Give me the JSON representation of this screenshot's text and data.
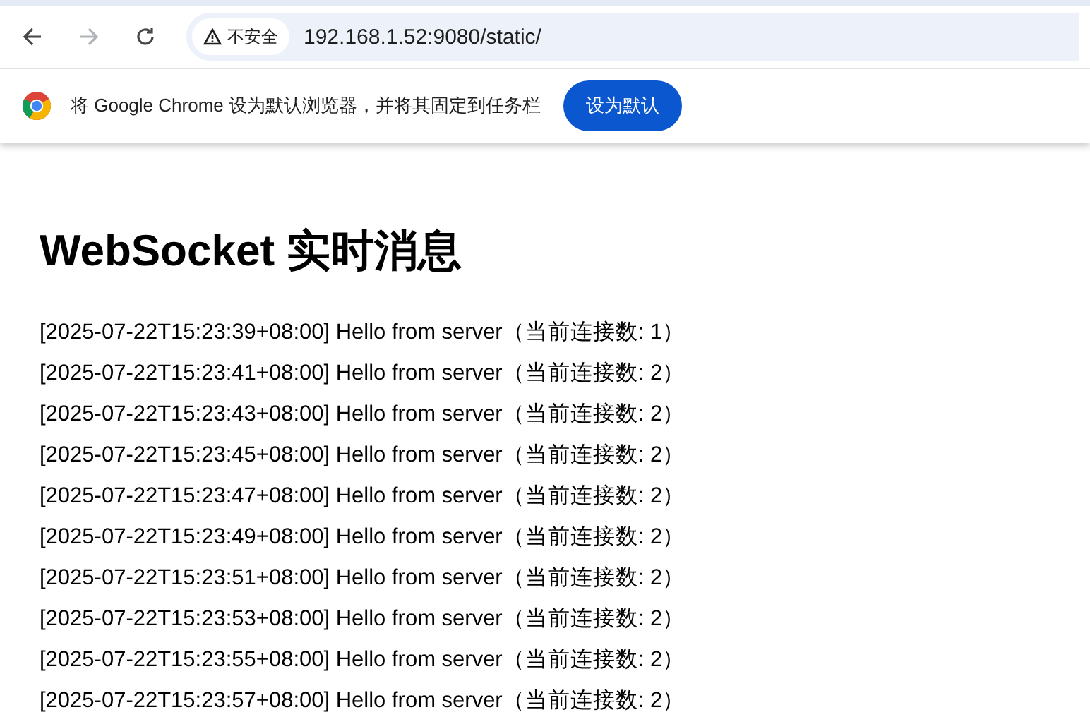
{
  "toolbar": {
    "nav_buttons": [
      {
        "kind": "back",
        "disabled": false
      },
      {
        "kind": "forward",
        "disabled": true
      },
      {
        "kind": "reload",
        "disabled": false
      }
    ],
    "security_badge": "不安全",
    "url": "192.168.1.52:9080/static/"
  },
  "infobar": {
    "message": "将 Google Chrome 设为默认浏览器，并将其固定到任务栏",
    "button": "设为默认"
  },
  "page": {
    "heading": "WebSocket 实时消息",
    "messages": [
      "[2025-07-22T15:23:39+08:00] Hello from server（当前连接数: 1）",
      "[2025-07-22T15:23:41+08:00] Hello from server（当前连接数: 2）",
      "[2025-07-22T15:23:43+08:00] Hello from server（当前连接数: 2）",
      "[2025-07-22T15:23:45+08:00] Hello from server（当前连接数: 2）",
      "[2025-07-22T15:23:47+08:00] Hello from server（当前连接数: 2）",
      "[2025-07-22T15:23:49+08:00] Hello from server（当前连接数: 2）",
      "[2025-07-22T15:23:51+08:00] Hello from server（当前连接数: 2）",
      "[2025-07-22T15:23:53+08:00] Hello from server（当前连接数: 2）",
      "[2025-07-22T15:23:55+08:00] Hello from server（当前连接数: 2）",
      "[2025-07-22T15:23:57+08:00] Hello from server（当前连接数: 2）"
    ]
  }
}
